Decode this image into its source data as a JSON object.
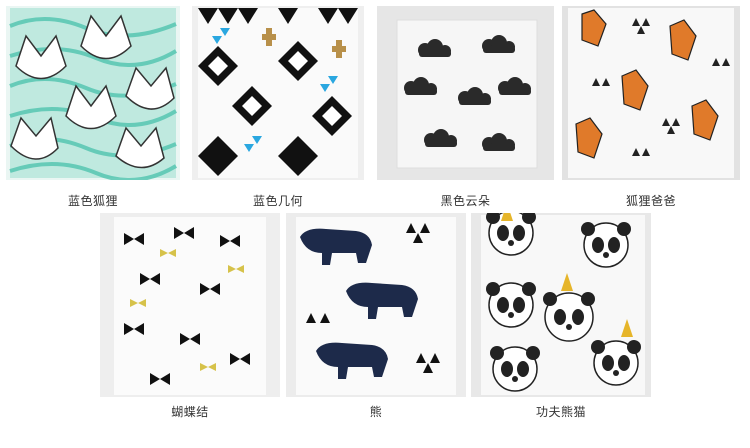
{
  "products": [
    {
      "name": "蓝色狐狸",
      "pattern": "teal-fox",
      "main_color": "#7fd6c6"
    },
    {
      "name": "蓝色几何",
      "pattern": "geometric-triangles",
      "main_color": "#2aa7e0"
    },
    {
      "name": "黑色云朵",
      "pattern": "black-clouds",
      "main_color": "#222222"
    },
    {
      "name": "狐狸爸爸",
      "pattern": "orange-fox",
      "main_color": "#e07a2a"
    },
    {
      "name": "蝴蝶结",
      "pattern": "bow-ties",
      "main_color": "#111111"
    },
    {
      "name": "熊",
      "pattern": "navy-bear",
      "main_color": "#1d2a4a"
    },
    {
      "name": "功夫熊猫",
      "pattern": "panda",
      "main_color": "#222222"
    }
  ]
}
